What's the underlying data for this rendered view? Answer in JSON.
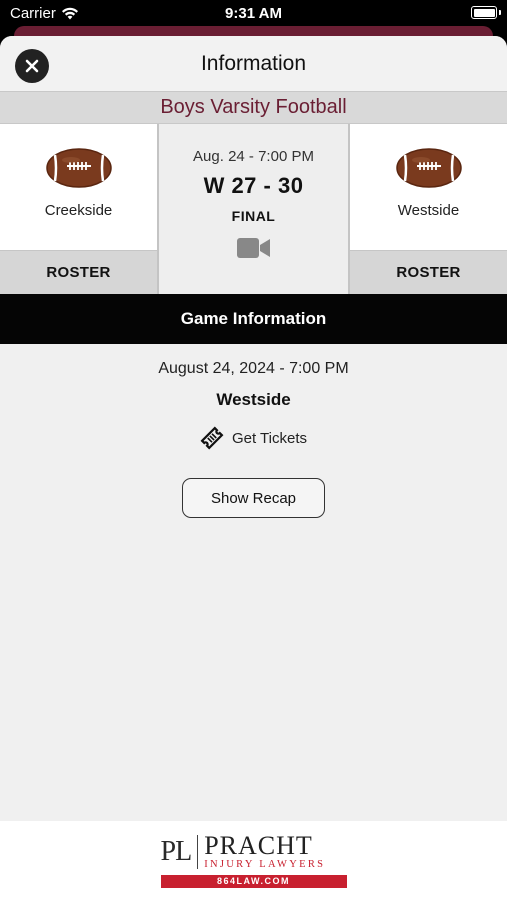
{
  "status_bar": {
    "carrier": "Carrier",
    "time": "9:31 AM"
  },
  "header": {
    "title": "Information",
    "close_icon": "close-icon"
  },
  "sport": "Boys Varsity Football",
  "matchup": {
    "home": {
      "name": "Creekside",
      "roster_label": "ROSTER",
      "icon": "football-icon"
    },
    "away": {
      "name": "Westside",
      "roster_label": "ROSTER",
      "icon": "football-icon"
    },
    "date": "Aug. 24 - 7:00 PM",
    "result": "W 27 - 30",
    "status": "FINAL",
    "video_icon": "video-camera-icon"
  },
  "game_info": {
    "heading": "Game Information",
    "datetime": "August 24, 2024 - 7:00 PM",
    "location": "Westside",
    "tickets_label": "Get Tickets",
    "tickets_icon": "ticket-icon",
    "recap_label": "Show Recap"
  },
  "ad": {
    "monogram": "PL",
    "brand": "PRACHT",
    "tagline": "INJURY LAWYERS",
    "url": "864LAW.COM"
  },
  "colors": {
    "maroon": "#6a1e33",
    "ad_red": "#c8202f",
    "football": "#7a3a1e"
  }
}
